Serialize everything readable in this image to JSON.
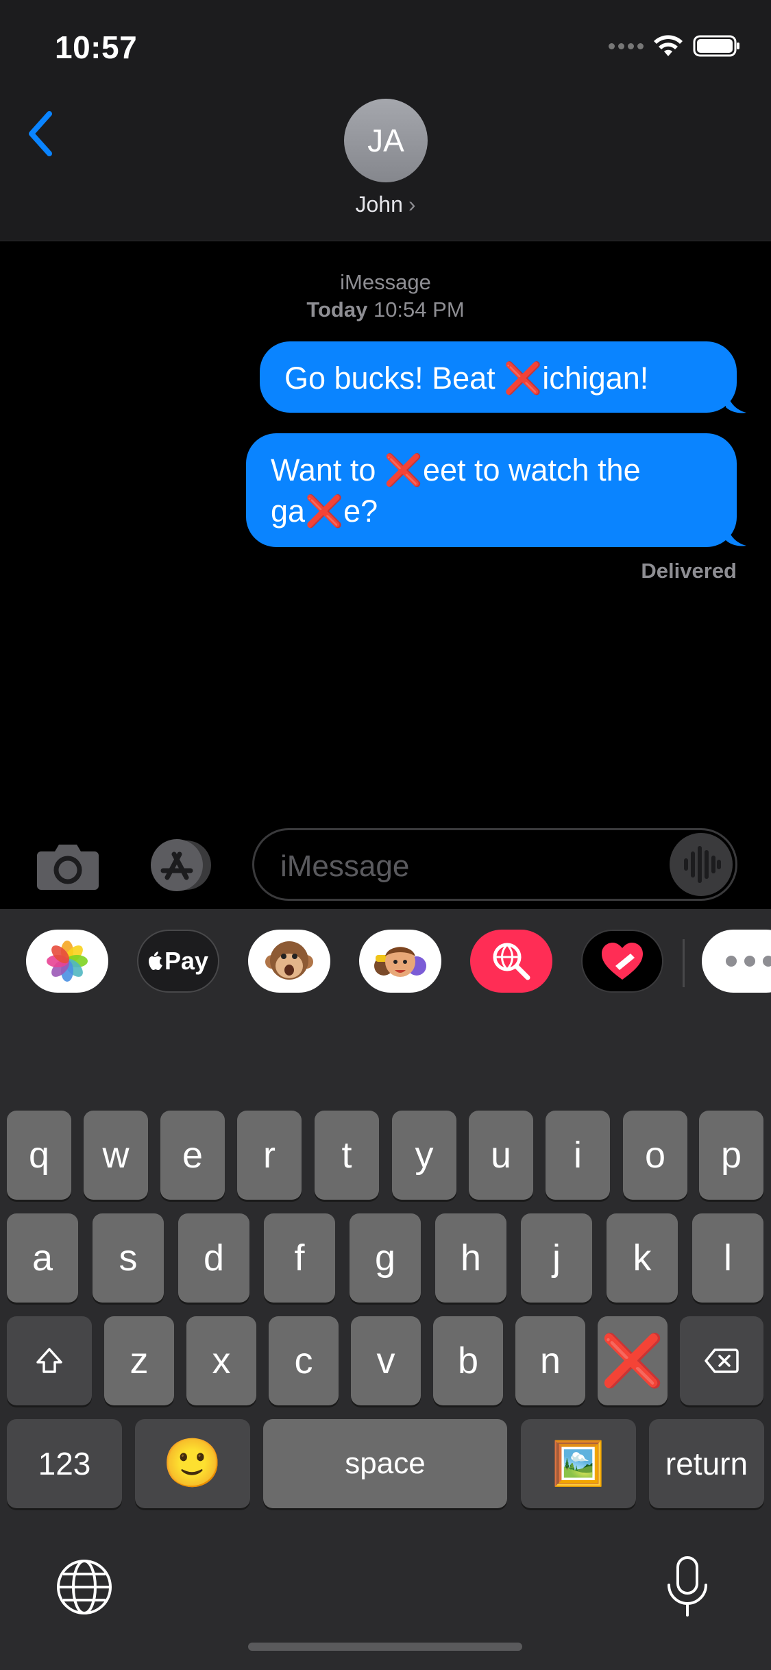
{
  "status_bar": {
    "time": "10:57"
  },
  "header": {
    "avatar_initials": "JA",
    "contact_name": "John",
    "chevron": "›"
  },
  "conversation": {
    "service": "iMessage",
    "date_label": "Today",
    "time_label": "10:54 PM",
    "messages": [
      {
        "parts": [
          "Go bucks! Beat ",
          "❌",
          "ichigan!"
        ]
      },
      {
        "parts": [
          "Want to ",
          "❌",
          "eet to watch the",
          "ga",
          "❌",
          "e?"
        ]
      }
    ],
    "delivery_status": "Delivered"
  },
  "composer": {
    "placeholder": "iMessage"
  },
  "app_strip": {
    "apple_pay_label": "Pay",
    "apps": [
      "photos-app-icon",
      "apple-pay-app-icon",
      "animoji-app-icon",
      "memoji-app-icon",
      "image-search-app-icon",
      "digital-touch-app-icon",
      "more-apps-icon"
    ]
  },
  "keyboard": {
    "row1": [
      "q",
      "w",
      "e",
      "r",
      "t",
      "y",
      "u",
      "i",
      "o",
      "p"
    ],
    "row2": [
      "a",
      "s",
      "d",
      "f",
      "g",
      "h",
      "j",
      "k",
      "l"
    ],
    "row3": [
      "z",
      "x",
      "c",
      "v",
      "b",
      "n",
      "❌"
    ],
    "numbers_label": "123",
    "emoji_label": "🙂",
    "space_label": "space",
    "image_label": "🖼️",
    "return_label": "return"
  },
  "colors": {
    "accent": "#0a84ff",
    "bubble_text": "#ffffff",
    "x_mark": "#e00000",
    "key": "#6b6b6b",
    "key_dark": "#464648"
  }
}
